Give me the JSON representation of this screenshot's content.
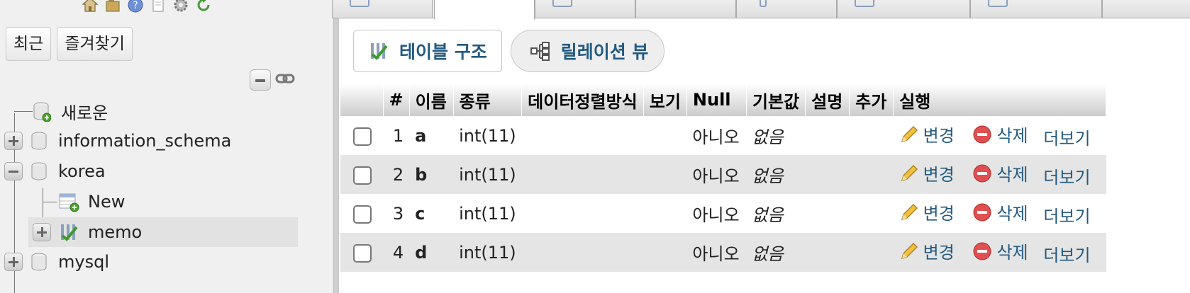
{
  "nav": {
    "tabs": [
      "최근",
      "즐겨찾기"
    ],
    "top_icons": [
      "home-icon",
      "database-icon",
      "help-icon",
      "documentation-icon",
      "settings-icon",
      "reload-icon"
    ]
  },
  "tree": {
    "new_db": "새로운",
    "databases": [
      {
        "name": "information_schema",
        "expanded": false
      },
      {
        "name": "korea",
        "expanded": true
      },
      {
        "name": "mysql",
        "expanded": false
      }
    ],
    "korea_children": [
      "New",
      "memo"
    ]
  },
  "subnav": {
    "structure": "테이블 구조",
    "relation": "릴레이션 뷰"
  },
  "table": {
    "headers": [
      "#",
      "이름",
      "종류",
      "데이터정렬방식",
      "보기",
      "Null",
      "기본값",
      "설명",
      "추가",
      "실행"
    ],
    "rows": [
      {
        "num": "1",
        "name": "a",
        "type": "int(11)",
        "null": "아니오",
        "default": "없음"
      },
      {
        "num": "2",
        "name": "b",
        "type": "int(11)",
        "null": "아니오",
        "default": "없음"
      },
      {
        "num": "3",
        "name": "c",
        "type": "int(11)",
        "null": "아니오",
        "default": "없음"
      },
      {
        "num": "4",
        "name": "d",
        "type": "int(11)",
        "null": "아니오",
        "default": "없음"
      }
    ],
    "actions": {
      "change": "변경",
      "drop": "삭제",
      "more": "더보기"
    }
  },
  "colors": {
    "link": "#235a81",
    "panel_bg": "#f0f0f0",
    "row_alt": "#e5e5e5"
  }
}
